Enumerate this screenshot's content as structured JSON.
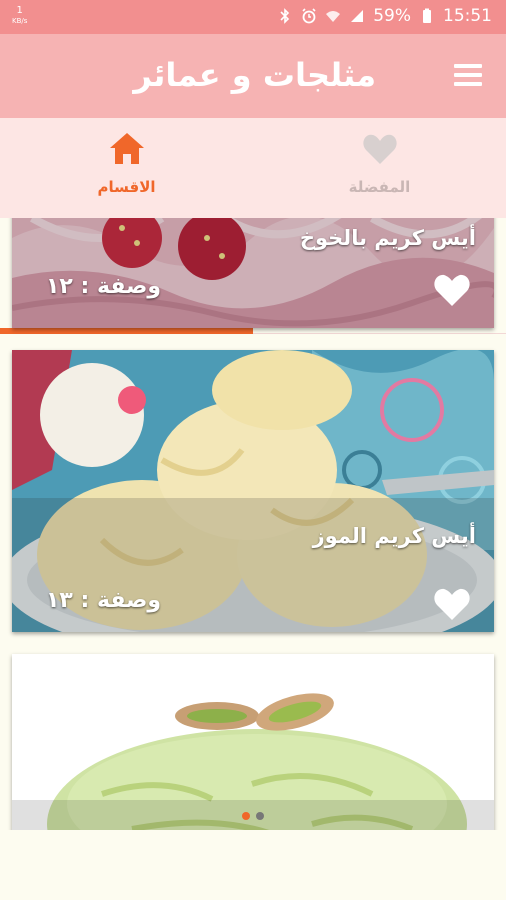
{
  "statusbar": {
    "speed_value": "1",
    "speed_unit": "KB/s",
    "battery": "59%",
    "time": "15:51"
  },
  "appbar": {
    "title": "مثلجات و عمائر"
  },
  "tabs": [
    {
      "label": "الاقسام",
      "icon": "home-icon",
      "active": true
    },
    {
      "label": "المفضلة",
      "icon": "heart-icon",
      "active": false
    }
  ],
  "recipes": [
    {
      "name": "أيس كريم بالخوخ",
      "count_text": "وصفة : ١٢"
    },
    {
      "name": "أيس كريم الموز",
      "count_text": "وصفة : ١٣"
    }
  ],
  "colors": {
    "statusbar": "#f28f8f",
    "appbar": "#f6b3b3",
    "tabs_bg": "#fde6e4",
    "accent": "#f0672a",
    "inactive": "#c9b6b4",
    "background": "#fdfcf0"
  }
}
